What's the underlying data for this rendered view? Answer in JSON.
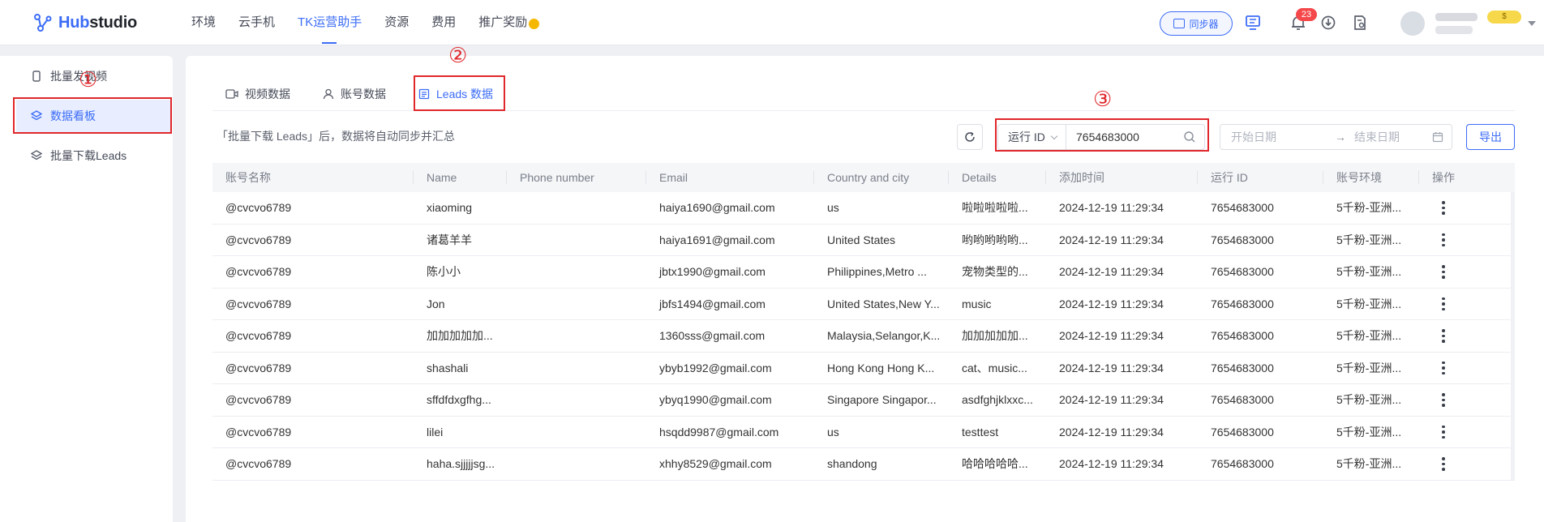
{
  "topbar": {
    "logo_text_hub": "Hub",
    "logo_text_studio": "studio",
    "nav": [
      "环境",
      "云手机",
      "TK运营助手",
      "资源",
      "费用",
      "推广奖励"
    ],
    "active_nav": "TK运营助手",
    "sync_label": "同步器",
    "notification_count": "23",
    "vip_label": "$"
  },
  "sidebar": {
    "items": [
      {
        "label": "批量发视频",
        "icon": "phone-icon"
      },
      {
        "label": "数据看板",
        "icon": "layers-icon"
      },
      {
        "label": "批量下载Leads",
        "icon": "layers-icon"
      }
    ],
    "active": "数据看板"
  },
  "tabs": [
    {
      "label": "视频数据",
      "icon": "video-icon"
    },
    {
      "label": "账号数据",
      "icon": "user-icon"
    },
    {
      "label": "Leads 数据",
      "icon": "list-icon"
    }
  ],
  "active_tab": "Leads 数据",
  "toolbar": {
    "hint": "「批量下载 Leads」后，数据将自动同步并汇总",
    "filter_select": "运行 ID",
    "filter_value": "7654683000",
    "start_date_placeholder": "开始日期",
    "end_date_placeholder": "结束日期",
    "arrow": "→",
    "export_label": "导出"
  },
  "table": {
    "columns": [
      "账号名称",
      "Name",
      "Phone number",
      "Email",
      "Country and city",
      "Details",
      "添加时间",
      "运行 ID",
      "账号环境",
      "操作"
    ],
    "rows": [
      [
        "@cvcvo6789",
        "xiaoming",
        "",
        "haiya1690@gmail.com",
        "us",
        "啦啦啦啦啦...",
        "2024-12-19 11:29:34",
        "7654683000",
        "5千粉-亚洲..."
      ],
      [
        "@cvcvo6789",
        "诸葛羊羊",
        "",
        "haiya1691@gmail.com",
        "United States",
        "哟哟哟哟哟...",
        "2024-12-19 11:29:34",
        "7654683000",
        "5千粉-亚洲..."
      ],
      [
        "@cvcvo6789",
        "陈小小",
        "",
        "jbtx1990@gmail.com",
        "Philippines,Metro ...",
        "宠物类型的...",
        "2024-12-19 11:29:34",
        "7654683000",
        "5千粉-亚洲..."
      ],
      [
        "@cvcvo6789",
        "Jon",
        "",
        "jbfs1494@gmail.com",
        "United States,New Y...",
        "music",
        "2024-12-19 11:29:34",
        "7654683000",
        "5千粉-亚洲..."
      ],
      [
        "@cvcvo6789",
        "加加加加加...",
        "",
        "1360sss@gmail.com",
        "Malaysia,Selangor,K...",
        "加加加加加...",
        "2024-12-19 11:29:34",
        "7654683000",
        "5千粉-亚洲..."
      ],
      [
        "@cvcvo6789",
        "shashali",
        "",
        "ybyb1992@gmail.com",
        "Hong Kong Hong K...",
        "cat、music...",
        "2024-12-19 11:29:34",
        "7654683000",
        "5千粉-亚洲..."
      ],
      [
        "@cvcvo6789",
        "sffdfdxgfhg...",
        "",
        "ybyq1990@gmail.com",
        "Singapore Singapor...",
        "asdfghjklxxc...",
        "2024-12-19 11:29:34",
        "7654683000",
        "5千粉-亚洲..."
      ],
      [
        "@cvcvo6789",
        "lilei",
        "",
        "hsqdd9987@gmail.com",
        "us",
        "testtest",
        "2024-12-19 11:29:34",
        "7654683000",
        "5千粉-亚洲..."
      ],
      [
        "@cvcvo6789",
        "haha.sjjjjjsg...",
        "",
        "xhhy8529@gmail.com",
        "shandong",
        "哈哈哈哈哈...",
        "2024-12-19 11:29:34",
        "7654683000",
        "5千粉-亚洲..."
      ]
    ]
  },
  "annotations": [
    "①",
    "②",
    "③"
  ],
  "colors": {
    "accent": "#3b6cf6",
    "annotation": "#e0272b"
  }
}
